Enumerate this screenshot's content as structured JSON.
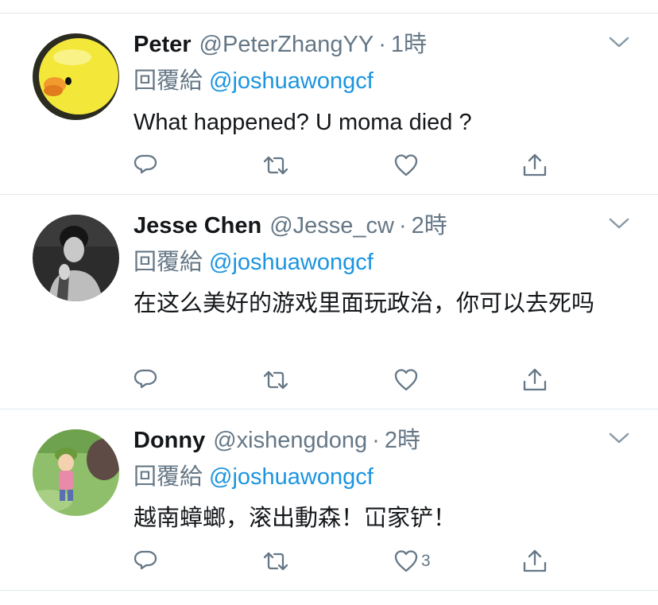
{
  "colors": {
    "link": "#1b95e0",
    "secondary": "#657786",
    "divider": "#e1e8ed",
    "text": "#14171a"
  },
  "tweets": [
    {
      "name": "Peter",
      "handle": "@PeterZhangYY",
      "dot": "·",
      "time": "1時",
      "reply_prefix": "回覆給",
      "reply_to": "@joshuawongcf",
      "text": "What happened? U moma died ?",
      "avatar_icon": "yellow-chick-avatar",
      "like_count": ""
    },
    {
      "name": "Jesse Chen",
      "handle": "@Jesse_cw",
      "dot": "·",
      "time": "2時",
      "reply_prefix": "回覆給",
      "reply_to": "@joshuawongcf",
      "text": "在这么美好的游戏里面玩政治，你可以去死吗",
      "avatar_icon": "person-photo-avatar",
      "like_count": ""
    },
    {
      "name": "Donny",
      "handle": "@xishengdong",
      "dot": "·",
      "time": "2時",
      "reply_prefix": "回覆給",
      "reply_to": "@joshuawongcf",
      "text": "越南蟑螂，滚出動森！冚家铲！",
      "avatar_icon": "game-character-avatar",
      "like_count": "3"
    }
  ],
  "icons": [
    "reply-icon",
    "retweet-icon",
    "like-icon",
    "share-icon",
    "chevron-down-icon"
  ]
}
